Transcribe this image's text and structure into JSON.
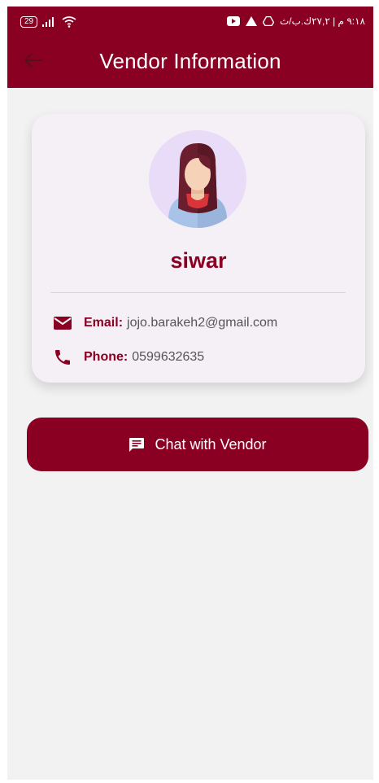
{
  "status_bar": {
    "battery": "29",
    "time_text": "٩:١٨ م | ٢٧,٢ك.ب/ث"
  },
  "app_bar": {
    "title": "Vendor Information",
    "back_icon": "arrow-left-icon"
  },
  "vendor": {
    "name": "siwar",
    "email_label": "Email:",
    "email": "jojo.barakeh2@gmail.com",
    "phone_label": "Phone:",
    "phone": "0599632635"
  },
  "chat_button": {
    "label": "Chat with Vendor",
    "icon": "chat-icon"
  },
  "colors": {
    "primary": "#8a0022",
    "card_bg": "#f5eff6",
    "screen_bg": "#f2f2f2",
    "avatar_bg": "#e8dcf8"
  }
}
